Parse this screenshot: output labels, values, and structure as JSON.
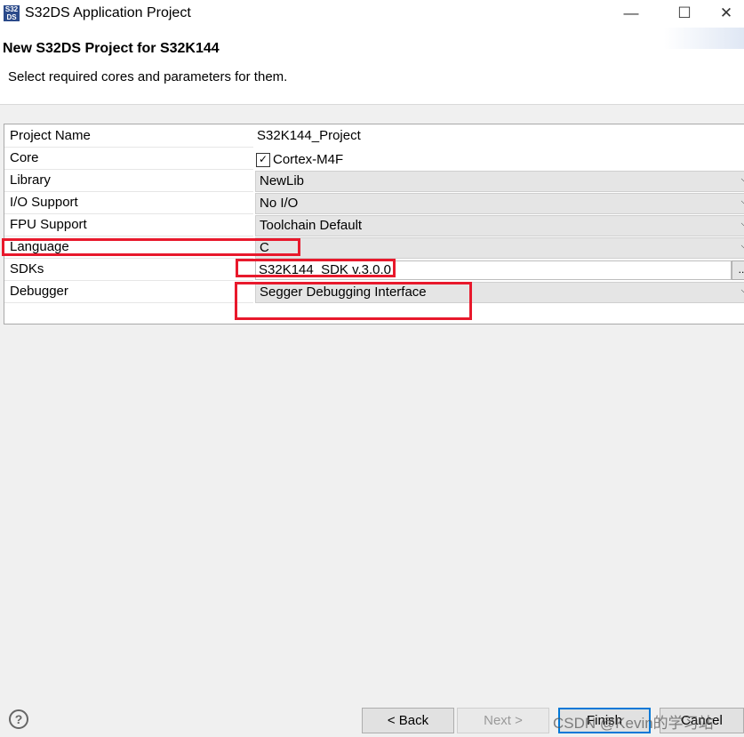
{
  "window": {
    "title": "S32DS Application Project",
    "app_icon_text": "S32\nDS",
    "minimize_glyph": "—",
    "maximize_glyph": "☐",
    "close_glyph": "✕"
  },
  "header": {
    "title": "New S32DS Project for S32K144",
    "description": "Select required cores and parameters for them."
  },
  "rows": {
    "project_name": {
      "label": "Project Name",
      "value": "S32K144_Project"
    },
    "core": {
      "label": "Core",
      "value": "Cortex-M4F",
      "checked": true,
      "check_glyph": "✓"
    },
    "library": {
      "label": "Library",
      "value": "NewLib"
    },
    "io_support": {
      "label": "I/O Support",
      "value": "No I/O"
    },
    "fpu_support": {
      "label": "FPU Support",
      "value": "Toolchain Default"
    },
    "language": {
      "label": "Language",
      "value": "C"
    },
    "sdks": {
      "label": "SDKs",
      "value": "S32K144_SDK v.3.0.0",
      "browse_label": ".."
    },
    "debugger": {
      "label": "Debugger",
      "value": "Segger Debugging Interface"
    }
  },
  "chevron_glyph": "⌵",
  "footer": {
    "help_glyph": "?",
    "back_label": "< Back",
    "next_label": "Next >",
    "finish_label": "Finish",
    "cancel_label": "Cancel"
  },
  "watermark": "CSDN @Kevin的学习站",
  "colors": {
    "highlight": "#e8192c",
    "default_button_border": "#0078d7"
  }
}
